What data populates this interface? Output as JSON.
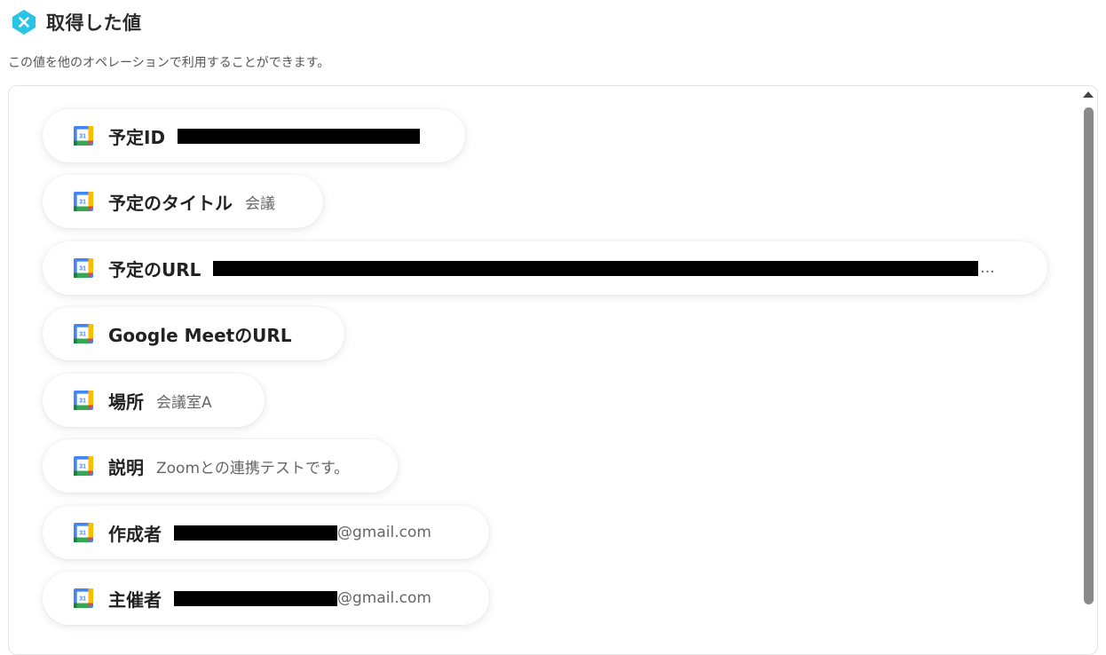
{
  "header": {
    "icon": "yoom-logo-icon",
    "title": "取得した値",
    "subtitle": "この値を他のオペレーションで利用することができます。"
  },
  "colors": {
    "logo": "#27c4e6",
    "pill_background": "#ffffff",
    "scrollbar_thumb": "#8a8a8a",
    "redaction": "#000000"
  },
  "fields": [
    {
      "icon": "google-calendar-icon",
      "label": "予定ID",
      "value": "",
      "redacted": true,
      "suffix": ""
    },
    {
      "icon": "google-calendar-icon",
      "label": "予定のタイトル",
      "value": "会議",
      "redacted": false,
      "suffix": ""
    },
    {
      "icon": "google-calendar-icon",
      "label": "予定のURL",
      "value": "",
      "redacted": true,
      "suffix": "..."
    },
    {
      "icon": "google-calendar-icon",
      "label": "Google MeetのURL",
      "value": "",
      "redacted": false,
      "suffix": ""
    },
    {
      "icon": "google-calendar-icon",
      "label": "場所",
      "value": "会議室A",
      "redacted": false,
      "suffix": ""
    },
    {
      "icon": "google-calendar-icon",
      "label": "説明",
      "value": "Zoomとの連携テストです。",
      "redacted": false,
      "suffix": ""
    },
    {
      "icon": "google-calendar-icon",
      "label": "作成者",
      "value": "",
      "redacted": true,
      "suffix": "@gmail.com"
    },
    {
      "icon": "google-calendar-icon",
      "label": "主催者",
      "value": "",
      "redacted": true,
      "suffix": "@gmail.com"
    }
  ]
}
